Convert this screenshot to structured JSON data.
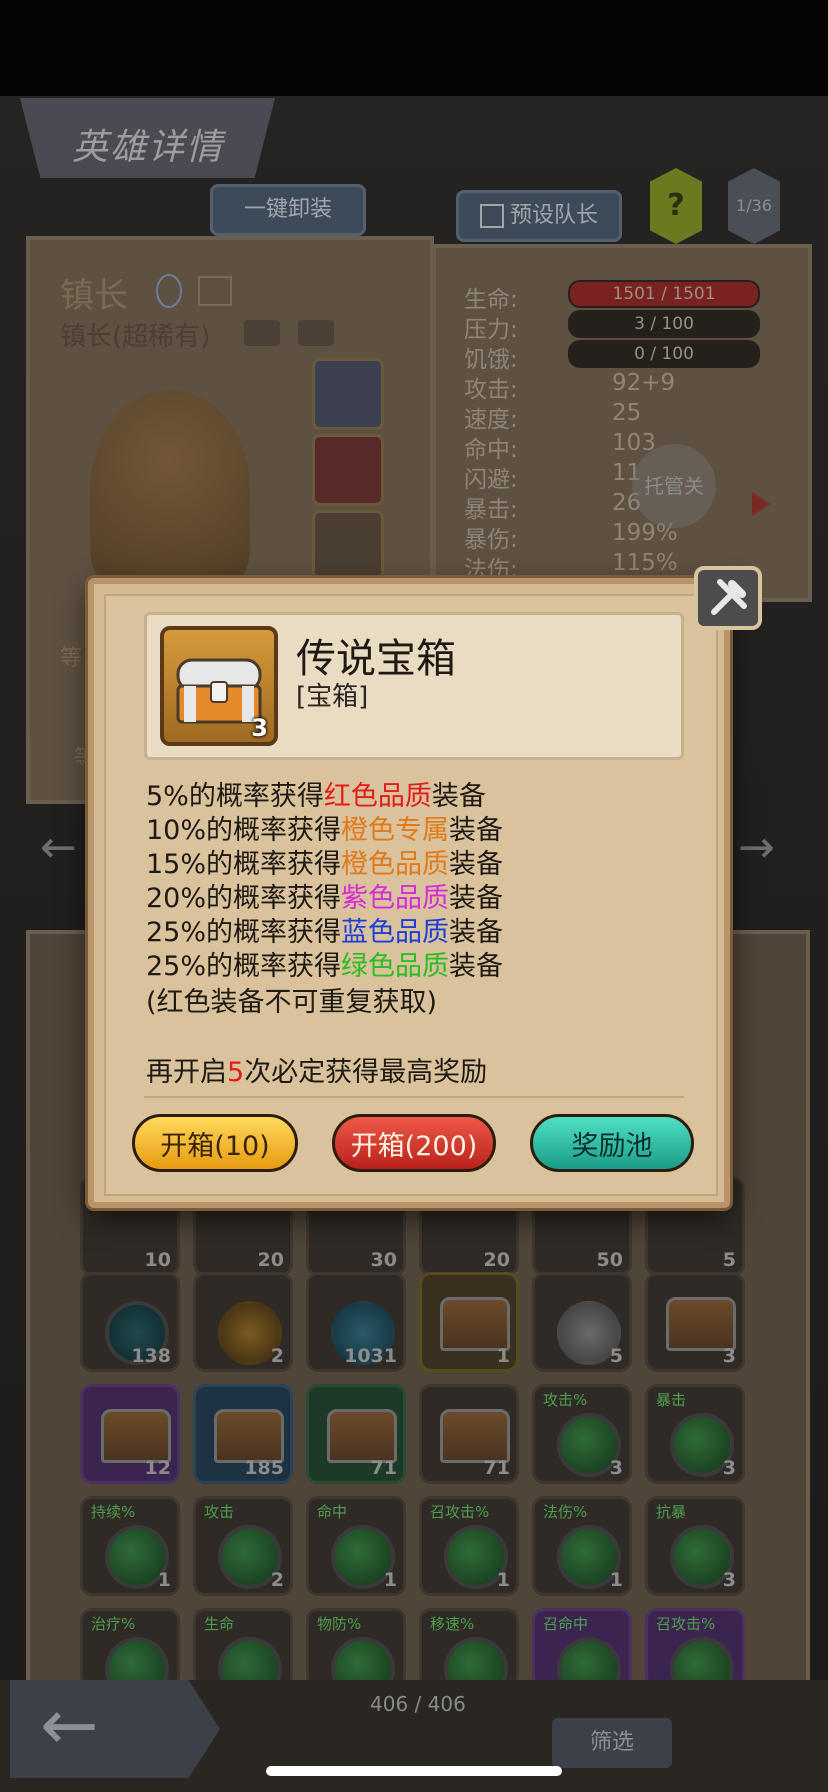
{
  "header": {
    "title": "英雄详情",
    "unequip_all": "一键卸装",
    "preset_leader": "预设队长",
    "help": "?",
    "page": "1/36"
  },
  "hero": {
    "name": "镇长",
    "subtitle": "镇长(超稀有)",
    "level_label": "等",
    "level_label2": "等"
  },
  "stats": [
    {
      "label": "生命:",
      "value": "1501 / 1501",
      "bar": "red"
    },
    {
      "label": "压力:",
      "value": "3 / 100",
      "bar": "dark"
    },
    {
      "label": "饥饿:",
      "value": "0 / 100",
      "bar": "dark"
    },
    {
      "label": "攻击:",
      "value": "92+9"
    },
    {
      "label": "速度:",
      "value": "25"
    },
    {
      "label": "命中:",
      "value": "103"
    },
    {
      "label": "闪避:",
      "value": "11"
    },
    {
      "label": "暴击:",
      "value": "26"
    },
    {
      "label": "暴伤:",
      "value": "199%"
    },
    {
      "label": "法伤:",
      "value": "115%"
    }
  ],
  "auto_button": "托管关",
  "popup": {
    "item_name": "传说宝箱",
    "item_type": "[宝箱]",
    "item_count": "3",
    "lines": [
      {
        "pre": "5%的概率获得",
        "hl": "红色品质",
        "post": "装备",
        "color": "#e31d1d"
      },
      {
        "pre": "10%的概率获得",
        "hl": "橙色专属",
        "post": "装备",
        "color": "#e07a1a"
      },
      {
        "pre": "15%的概率获得",
        "hl": "橙色品质",
        "post": "装备",
        "color": "#e07a1a"
      },
      {
        "pre": "20%的概率获得",
        "hl": "紫色品质",
        "post": "装备",
        "color": "#d52bd8"
      },
      {
        "pre": "25%的概率获得",
        "hl": "蓝色品质",
        "post": "装备",
        "color": "#1d3fd9"
      },
      {
        "pre": "25%的概率获得",
        "hl": "绿色品质",
        "post": "装备",
        "color": "#2bbd22"
      }
    ],
    "note": "(红色装备不可重复获取)",
    "guarantee_pre": "再开启",
    "guarantee_num": "5",
    "guarantee_post": "次必定获得最高奖励",
    "btn_open_10": "开箱(10)",
    "btn_open_200": "开箱(200)",
    "btn_pool": "奖励池"
  },
  "inventory": {
    "row1": [
      "10",
      "20",
      "30",
      "20",
      "50",
      "5"
    ],
    "row2": [
      "138",
      "2",
      "1031",
      "1",
      "5",
      "3"
    ],
    "row3": [
      {
        "count": "12",
        "tag": ""
      },
      {
        "count": "185",
        "tag": ""
      },
      {
        "count": "71",
        "tag": ""
      },
      {
        "count": "71",
        "tag": ""
      },
      {
        "count": "3",
        "tag": "攻击%"
      },
      {
        "count": "3",
        "tag": "暴击"
      }
    ],
    "row4": [
      {
        "count": "1",
        "tag": "持续%"
      },
      {
        "count": "2",
        "tag": "攻击"
      },
      {
        "count": "1",
        "tag": "命中"
      },
      {
        "count": "1",
        "tag": "召攻击%"
      },
      {
        "count": "1",
        "tag": "法伤%"
      },
      {
        "count": "3",
        "tag": "抗暴"
      }
    ],
    "row5": [
      {
        "tag": "治疗%"
      },
      {
        "tag": "生命"
      },
      {
        "tag": "物防%"
      },
      {
        "tag": "移速%"
      },
      {
        "tag": "召命中"
      },
      {
        "tag": "召攻击%"
      }
    ],
    "total": "406 / 406",
    "filter": "筛选"
  },
  "colors": {
    "accent_red": "#e31d1d",
    "popup_bg": "#d9c29c"
  }
}
